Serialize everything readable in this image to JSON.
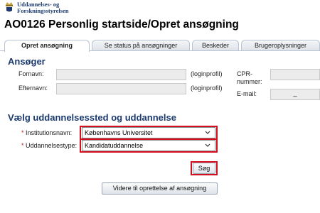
{
  "header": {
    "logo_line1": "Uddannelses- og",
    "logo_line2": "Forskningsstyrelsen",
    "title": "AO0126 Personlig startside/Opret ansøgning"
  },
  "tabs": [
    {
      "label": "Opret ansøgning"
    },
    {
      "label": "Se status på ansøgninger"
    },
    {
      "label": "Beskeder"
    },
    {
      "label": "Brugeroplysninger"
    }
  ],
  "applicant": {
    "section_title": "Ansøger",
    "first_name_label": "Fornavn:",
    "last_name_label": "Efternavn:",
    "loginprofil_note": "(loginprofil)",
    "cpr_label_line1": "CPR-",
    "cpr_label_line2": "nummer:",
    "email_label": "E-mail:",
    "email_value": "_"
  },
  "education": {
    "section_title": "Vælg uddannelsessted og uddannelse",
    "required_marker": "*",
    "institution_label": "Institutionsnavn:",
    "institution_value": "Københavns Universitet",
    "type_label": "Uddannelsestype:",
    "type_value": "Kandidatuddannelse",
    "search_button": "Søg",
    "continue_button": "Videre til oprettelse af ansøgning"
  },
  "colors": {
    "accent": "#1c3a6e",
    "highlight": "#d4101e"
  }
}
